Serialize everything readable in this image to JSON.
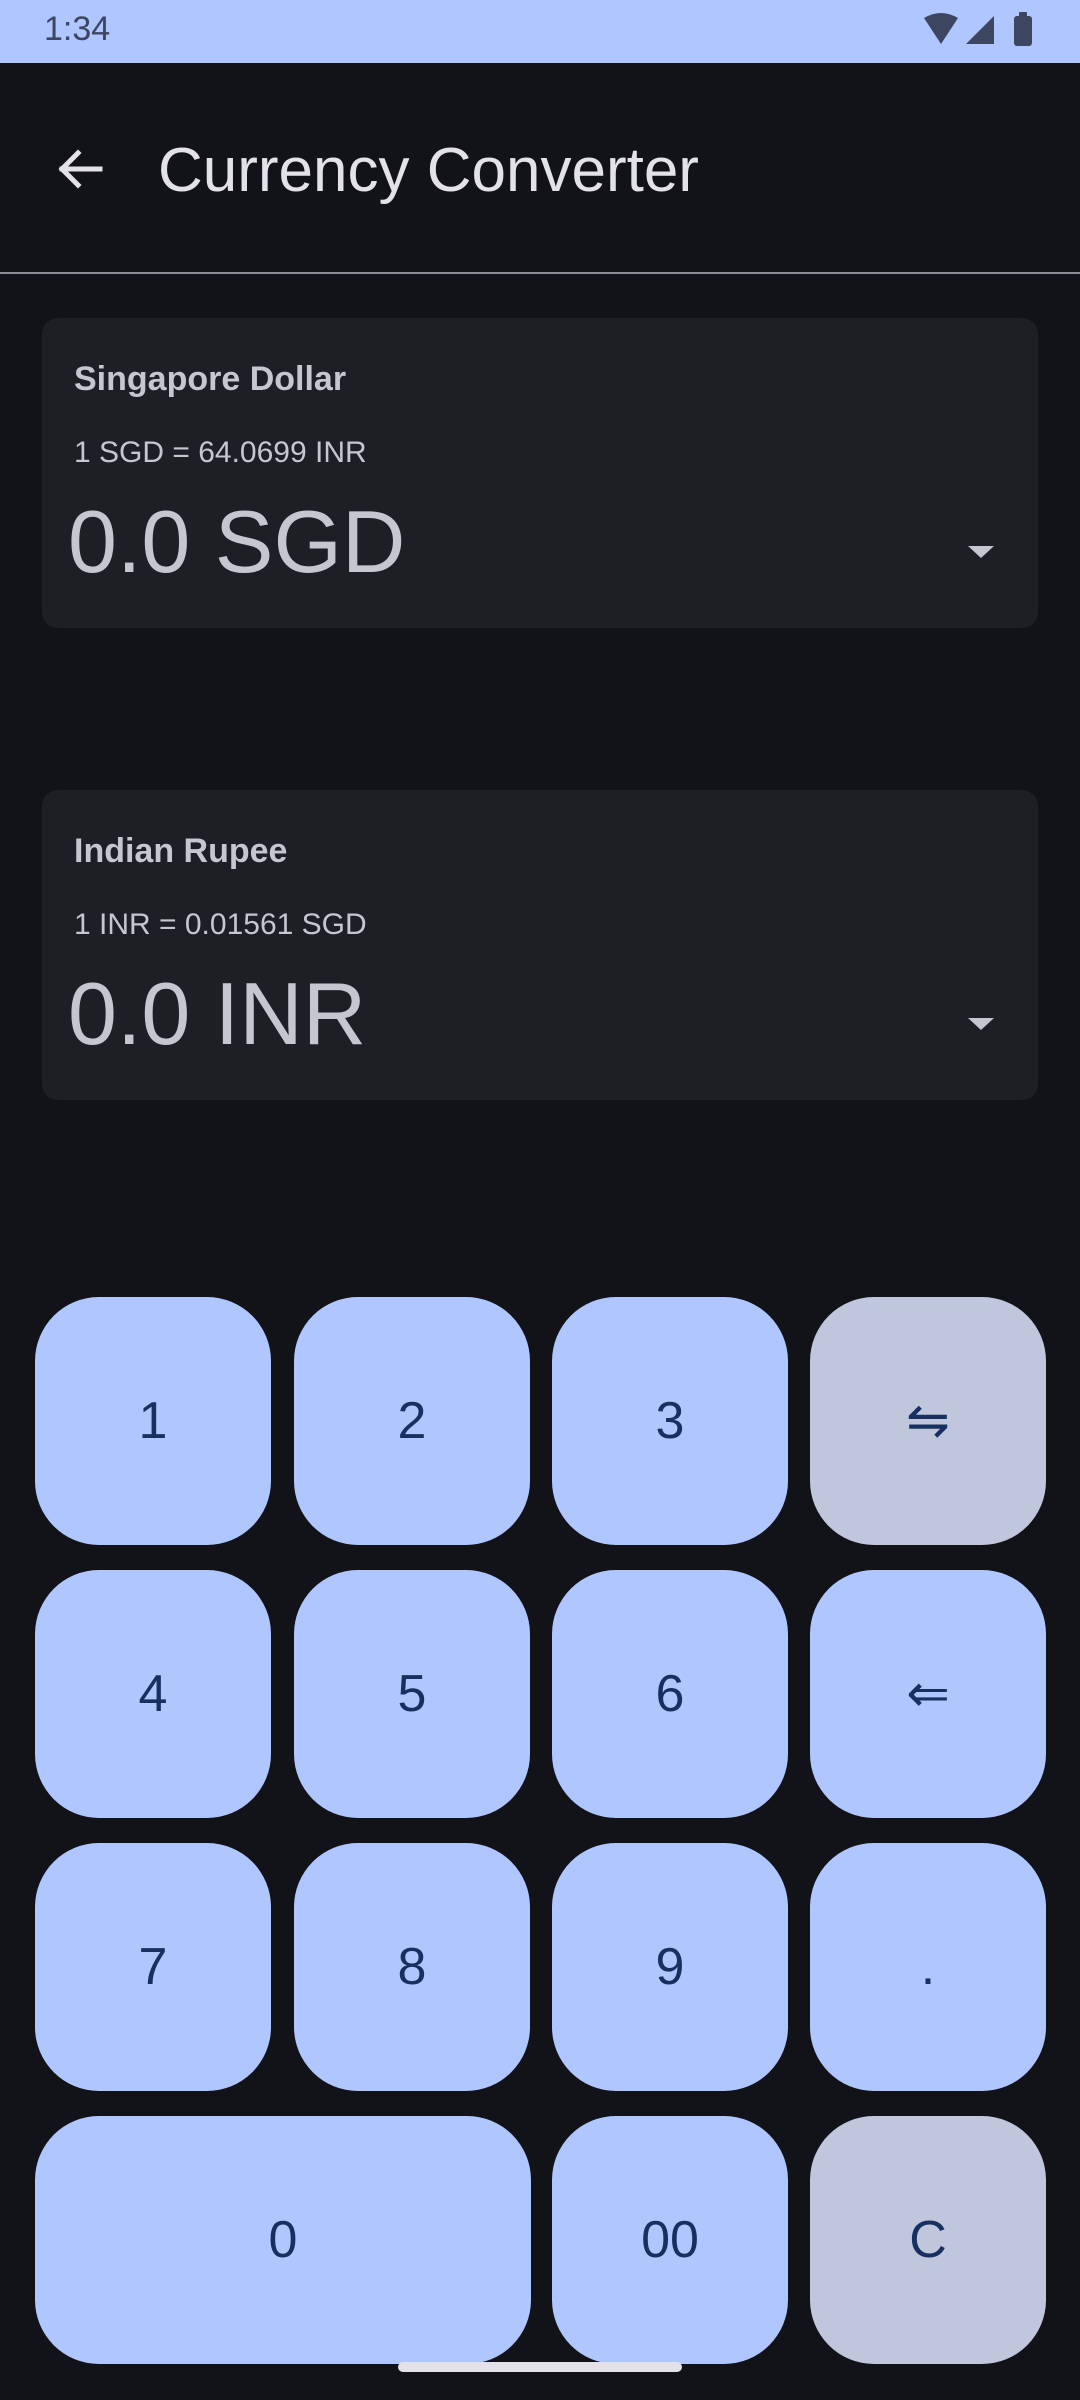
{
  "status_bar": {
    "time": "1:34",
    "icons": [
      "wifi-icon",
      "signal-icon",
      "battery-icon"
    ]
  },
  "app_bar": {
    "back_icon": "arrow-back-icon",
    "title": "Currency Converter"
  },
  "converter": {
    "from": {
      "name": "Singapore Dollar",
      "rate": "1 SGD = 64.0699 INR",
      "amount": "0.0 SGD"
    },
    "to": {
      "name": "Indian Rupee",
      "rate": "1 INR = 0.01561 SGD",
      "amount": "0.0 INR"
    }
  },
  "keypad": {
    "k1": "1",
    "k2": "2",
    "k3": "3",
    "swap": "⇋",
    "k4": "4",
    "k5": "5",
    "k6": "6",
    "backspace": "⇐",
    "k7": "7",
    "k8": "8",
    "k9": "9",
    "dot": ".",
    "k0": "0",
    "k00": "00",
    "clear": "C"
  },
  "colors": {
    "background": "#121318",
    "status_bar": "#b0c6ff",
    "card": "#1e1f24",
    "key_primary": "#b0c6ff",
    "key_secondary": "#c0c6dc",
    "key_text": "#17305f"
  }
}
